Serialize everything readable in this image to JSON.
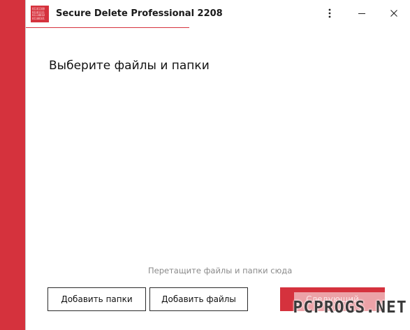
{
  "window": {
    "title": "Secure Delete Professional 2208",
    "logo_bits": "01101100\n01101111\n01110010\n01100101"
  },
  "controls": {
    "menu_icon": "kebab-vertical-icon",
    "minimize_icon": "minimize-icon",
    "close_icon": "close-icon"
  },
  "main": {
    "heading": "Выберите файлы и папки",
    "drop_hint": "Перетащите файлы и папки сюда"
  },
  "buttons": {
    "add_folders": "Добавить папки",
    "add_files": "Добавить файлы",
    "next": "Следующий"
  },
  "watermark": "PCPROGS.NET",
  "colors": {
    "accent": "#d5323d",
    "hint_text": "#8a8a8a"
  }
}
